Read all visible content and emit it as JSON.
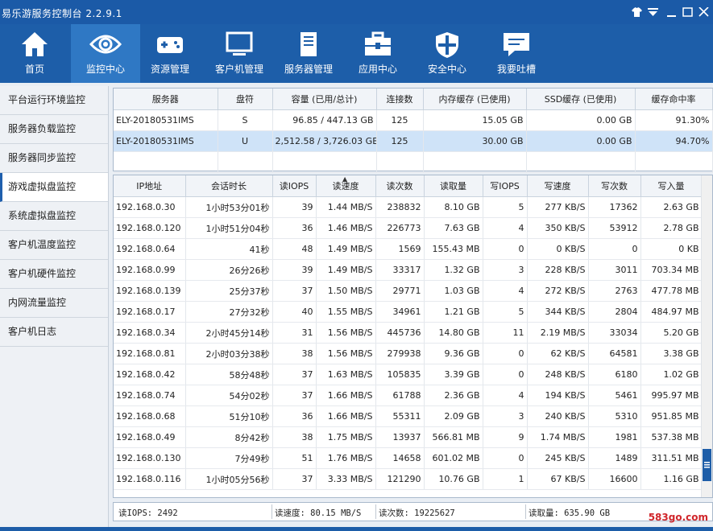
{
  "app": {
    "title": "易乐游服务控制台 2.2.9.1"
  },
  "nav": [
    {
      "label": "首页",
      "icon": "home-icon"
    },
    {
      "label": "监控中心",
      "icon": "eye-icon",
      "active": true
    },
    {
      "label": "资源管理",
      "icon": "gamepad-icon"
    },
    {
      "label": "客户机管理",
      "icon": "monitor-icon"
    },
    {
      "label": "服务器管理",
      "icon": "server-icon"
    },
    {
      "label": "应用中心",
      "icon": "toolbox-icon"
    },
    {
      "label": "安全中心",
      "icon": "shield-icon"
    },
    {
      "label": "我要吐槽",
      "icon": "chat-icon"
    }
  ],
  "sidebar": [
    {
      "label": "平台运行环境监控"
    },
    {
      "label": "服务器负载监控"
    },
    {
      "label": "服务器同步监控"
    },
    {
      "label": "游戏虚拟盘监控",
      "active": true
    },
    {
      "label": "系统虚拟盘监控"
    },
    {
      "label": "客户机温度监控"
    },
    {
      "label": "客户机硬件监控"
    },
    {
      "label": "内网流量监控"
    },
    {
      "label": "客户机日志"
    }
  ],
  "server_table": {
    "columns": [
      "服务器",
      "盘符",
      "容量 (已用/总计)",
      "连接数",
      "内存缓存 (已使用)",
      "SSD缓存 (已使用)",
      "缓存命中率"
    ],
    "rows": [
      [
        "ELY-20180531IMS",
        "S",
        "96.85 / 447.13 GB",
        "125",
        "15.05 GB",
        "0.00 GB",
        "91.30%"
      ],
      [
        "ELY-20180531IMS",
        "U",
        "2,512.58 / 3,726.03 GB",
        "125",
        "30.00 GB",
        "0.00 GB",
        "94.70%"
      ]
    ],
    "selected_row": 1
  },
  "client_table": {
    "columns": [
      "IP地址",
      "会话时长",
      "读IOPS",
      "读速度",
      "读次数",
      "读取量",
      "写IOPS",
      "写速度",
      "写次数",
      "写入量"
    ],
    "sorted_column": "读速度",
    "rows": [
      [
        "192.168.0.30",
        "1小时53分01秒",
        "39",
        "1.44 MB/S",
        "238832",
        "8.10 GB",
        "5",
        "277 KB/S",
        "17362",
        "2.63 GB"
      ],
      [
        "192.168.0.120",
        "1小时51分04秒",
        "36",
        "1.46 MB/S",
        "226773",
        "7.63 GB",
        "4",
        "350 KB/S",
        "53912",
        "2.78 GB"
      ],
      [
        "192.168.0.64",
        "41秒",
        "48",
        "1.49 MB/S",
        "1569",
        "155.43 MB",
        "0",
        "0 KB/S",
        "0",
        "0 KB"
      ],
      [
        "192.168.0.99",
        "26分26秒",
        "39",
        "1.49 MB/S",
        "33317",
        "1.32 GB",
        "3",
        "228 KB/S",
        "3011",
        "703.34 MB"
      ],
      [
        "192.168.0.139",
        "25分37秒",
        "37",
        "1.50 MB/S",
        "29771",
        "1.03 GB",
        "4",
        "272 KB/S",
        "2763",
        "477.78 MB"
      ],
      [
        "192.168.0.17",
        "27分32秒",
        "40",
        "1.55 MB/S",
        "34961",
        "1.21 GB",
        "5",
        "344 KB/S",
        "2804",
        "484.97 MB"
      ],
      [
        "192.168.0.34",
        "2小时45分14秒",
        "31",
        "1.56 MB/S",
        "445736",
        "14.80 GB",
        "11",
        "2.19 MB/S",
        "33034",
        "5.20 GB"
      ],
      [
        "192.168.0.81",
        "2小时03分38秒",
        "38",
        "1.56 MB/S",
        "279938",
        "9.36 GB",
        "0",
        "62 KB/S",
        "64581",
        "3.38 GB"
      ],
      [
        "192.168.0.42",
        "58分48秒",
        "37",
        "1.63 MB/S",
        "105835",
        "3.39 GB",
        "0",
        "248 KB/S",
        "6180",
        "1.02 GB"
      ],
      [
        "192.168.0.74",
        "54分02秒",
        "37",
        "1.66 MB/S",
        "61788",
        "2.36 GB",
        "4",
        "194 KB/S",
        "5461",
        "995.97 MB"
      ],
      [
        "192.168.0.68",
        "51分10秒",
        "36",
        "1.66 MB/S",
        "55311",
        "2.09 GB",
        "3",
        "240 KB/S",
        "5310",
        "951.85 MB"
      ],
      [
        "192.168.0.49",
        "8分42秒",
        "38",
        "1.75 MB/S",
        "13937",
        "566.81 MB",
        "9",
        "1.74 MB/S",
        "1981",
        "537.38 MB"
      ],
      [
        "192.168.0.130",
        "7分49秒",
        "51",
        "1.76 MB/S",
        "14658",
        "601.02 MB",
        "0",
        "245 KB/S",
        "1489",
        "311.51 MB"
      ],
      [
        "192.168.0.116",
        "1小时05分56秒",
        "37",
        "3.33 MB/S",
        "121290",
        "10.76 GB",
        "1",
        "67 KB/S",
        "16600",
        "1.16 GB"
      ]
    ]
  },
  "status": {
    "read_iops": "读IOPS: 2492",
    "read_speed": "读速度: 80.15 MB/S",
    "read_count": "读次数: 19225627",
    "read_amount": "读取量: 635.90 GB"
  },
  "watermark": "583go.com",
  "colors": {
    "accent": "#1d5da8",
    "selected": "#cfe3f8",
    "watermark": "#d0262b"
  }
}
